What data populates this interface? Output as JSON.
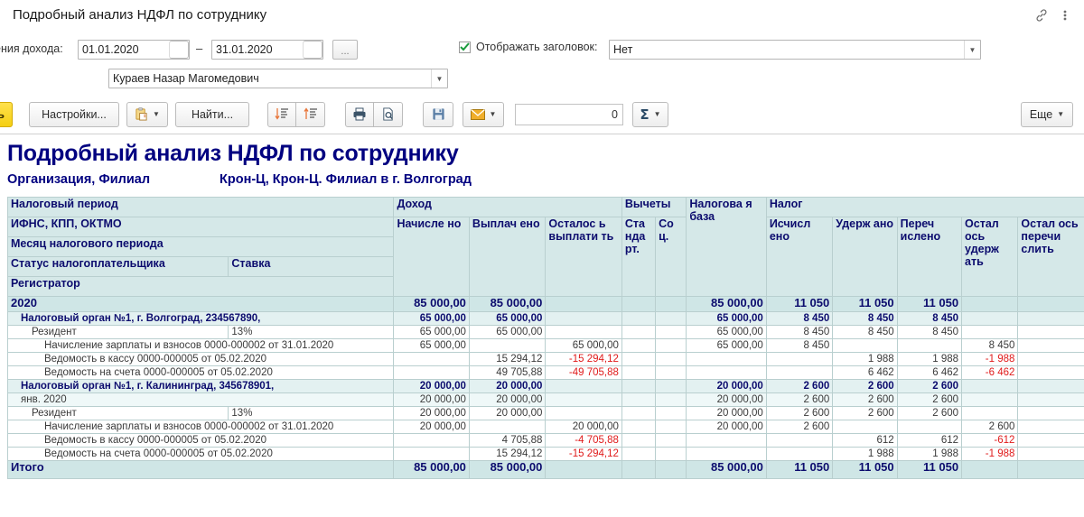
{
  "window": {
    "title": "Подробный анализ НДФЛ по сотруднику",
    "link_icon": "link-icon",
    "menu_icon": "more-vertical-icon"
  },
  "filters": {
    "period_label": "ения дохода:",
    "date_from": "01.01.2020",
    "date_to": "31.01.2020",
    "dash": "–",
    "ellipsis": "...",
    "employee": "Кураев Назар Магомедович",
    "show_header_label": "Отображать заголовок:",
    "show_header_checked": true,
    "header_value": "Нет"
  },
  "toolbar": {
    "left_badge": "ь",
    "settings": "Настройки...",
    "find": "Найти...",
    "sum_value": "0",
    "sigma": "Σ",
    "more": "Еще",
    "icons": {
      "clipboard": "clipboard-icon",
      "sort_desc": "sort-descending-icon",
      "sort_asc": "sort-ascending-icon",
      "print": "printer-icon",
      "preview": "print-preview-icon",
      "save": "save-icon",
      "mail": "envelope-icon"
    }
  },
  "report": {
    "title": "Подробный анализ НДФЛ по сотруднику",
    "sub_label": "Организация, Филиал",
    "sub_value": "Крон-Ц, Крон-Ц. Филиал в г. Волгоград"
  },
  "table": {
    "header_rows": {
      "r1_left": "Налоговый период",
      "r2_left": "ИФНС, КПП, ОКТМО",
      "r3_left": "Месяц налогового периода",
      "r4_left": "Статус налогоплательщика",
      "r4_rate": "Ставка",
      "r5_left": "Регистратор",
      "group_income": "Доход",
      "group_deductions": "Вычеты",
      "group_base": "Налогова я база",
      "group_tax": "Налог"
    },
    "columns": [
      "Начисле но",
      "Выплач ено",
      "Осталос ь выплати ть",
      "Ста нда рт.",
      "Со ц.",
      "Налогова я база",
      "Исчисл ено",
      "Удерж ано",
      "Переч ислено",
      "Остал ось удерж ать",
      "Остал ось перечи слить"
    ],
    "rows": [
      {
        "kind": "year",
        "label": "2020",
        "rate": "",
        "values": [
          "85 000,00",
          "85 000,00",
          "",
          "",
          "",
          "85 000,00",
          "11 050",
          "11 050",
          "11 050",
          "",
          ""
        ]
      },
      {
        "kind": "org",
        "label": "Налоговый орган №1, г. Волгоград, 234567890,",
        "rate": "",
        "values": [
          "65 000,00",
          "65 000,00",
          "",
          "",
          "",
          "65 000,00",
          "8 450",
          "8 450",
          "8 450",
          "",
          ""
        ]
      },
      {
        "kind": "status",
        "label": "Резидент",
        "rate": "13%",
        "values": [
          "65 000,00",
          "65 000,00",
          "",
          "",
          "",
          "65 000,00",
          "8 450",
          "8 450",
          "8 450",
          "",
          ""
        ]
      },
      {
        "kind": "doc",
        "label": "Начисление зарплаты и взносов 0000-000002 от 31.01.2020",
        "rate": "",
        "values": [
          "65 000,00",
          "",
          "65 000,00",
          "",
          "",
          "65 000,00",
          "8 450",
          "",
          "",
          "8 450",
          ""
        ]
      },
      {
        "kind": "doc",
        "label": "Ведомость в кассу 0000-000005 от 05.02.2020",
        "rate": "",
        "values": [
          "",
          "15 294,12",
          "-15 294,12",
          "",
          "",
          "",
          "",
          "1 988",
          "1 988",
          "-1 988",
          ""
        ]
      },
      {
        "kind": "doc",
        "label": "Ведомость на счета 0000-000005 от 05.02.2020",
        "rate": "",
        "values": [
          "",
          "49 705,88",
          "-49 705,88",
          "",
          "",
          "",
          "",
          "6 462",
          "6 462",
          "-6 462",
          ""
        ]
      },
      {
        "kind": "org",
        "label": "Налоговый орган №1, г. Калининград, 345678901,",
        "rate": "",
        "values": [
          "20 000,00",
          "20 000,00",
          "",
          "",
          "",
          "20 000,00",
          "2 600",
          "2 600",
          "2 600",
          "",
          ""
        ]
      },
      {
        "kind": "month",
        "label": "янв. 2020",
        "rate": "",
        "values": [
          "20 000,00",
          "20 000,00",
          "",
          "",
          "",
          "20 000,00",
          "2 600",
          "2 600",
          "2 600",
          "",
          ""
        ]
      },
      {
        "kind": "status",
        "label": "Резидент",
        "rate": "13%",
        "values": [
          "20 000,00",
          "20 000,00",
          "",
          "",
          "",
          "20 000,00",
          "2 600",
          "2 600",
          "2 600",
          "",
          ""
        ]
      },
      {
        "kind": "doc",
        "label": "Начисление зарплаты и взносов 0000-000002 от 31.01.2020",
        "rate": "",
        "values": [
          "20 000,00",
          "",
          "20 000,00",
          "",
          "",
          "20 000,00",
          "2 600",
          "",
          "",
          "2 600",
          ""
        ]
      },
      {
        "kind": "doc",
        "label": "Ведомость в кассу 0000-000005 от 05.02.2020",
        "rate": "",
        "values": [
          "",
          "4 705,88",
          "-4 705,88",
          "",
          "",
          "",
          "",
          "612",
          "612",
          "-612",
          ""
        ]
      },
      {
        "kind": "doc",
        "label": "Ведомость на счета 0000-000005 от 05.02.2020",
        "rate": "",
        "values": [
          "",
          "15 294,12",
          "-15 294,12",
          "",
          "",
          "",
          "",
          "1 988",
          "1 988",
          "-1 988",
          ""
        ]
      },
      {
        "kind": "total",
        "label": "Итого",
        "rate": "",
        "values": [
          "85 000,00",
          "85 000,00",
          "",
          "",
          "",
          "85 000,00",
          "11 050",
          "11 050",
          "11 050",
          "",
          ""
        ]
      }
    ]
  }
}
